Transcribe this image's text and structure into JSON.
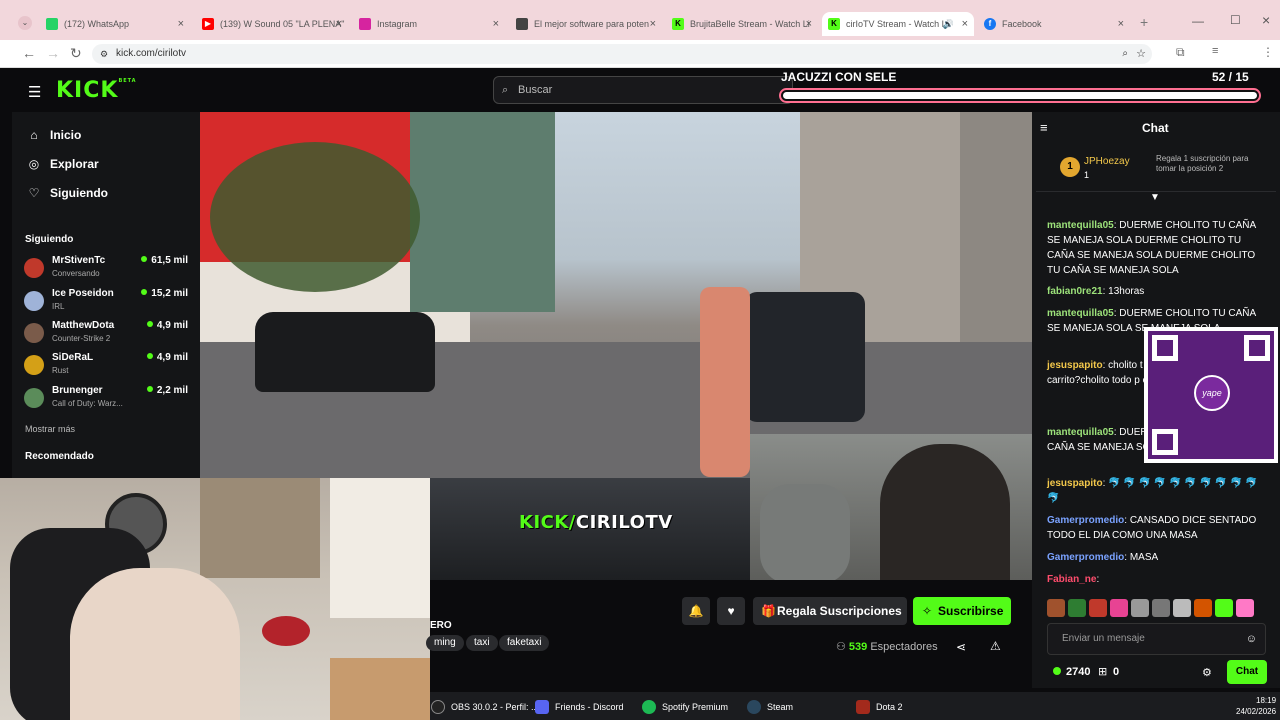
{
  "browser": {
    "tabs": [
      {
        "label": "(172) WhatsApp",
        "color": "#25d366"
      },
      {
        "label": "(139) W Sound 05 \"LA PLENA\"",
        "color": "#ff0000"
      },
      {
        "label": "Instagram",
        "color": "#d6249f"
      },
      {
        "label": "El mejor software para poten",
        "color": "#444444"
      },
      {
        "label": "BrujitaBelle Stream - Watch Li",
        "color": "#53fc18"
      },
      {
        "label": "cirIoTV Stream - Watch Li",
        "color": "#53fc18"
      },
      {
        "label": "Facebook",
        "color": "#1877f2"
      }
    ],
    "url": "kick.com/cirilotv"
  },
  "kick": {
    "logo": "KICK",
    "logo_beta": "BETA",
    "search_placeholder": "Buscar",
    "goal_title": "JACUZZI CON SELE",
    "goal_count": "52  / 15",
    "goal_progress": 1.0
  },
  "sidebar": {
    "nav": [
      {
        "label": "Inicio",
        "icon": "home-icon"
      },
      {
        "label": "Explorar",
        "icon": "compass-icon"
      },
      {
        "label": "Siguiendo",
        "icon": "heart-icon"
      }
    ],
    "following_title": "Siguiendo",
    "following": [
      {
        "name": "MrStivenTc",
        "category": "Conversando",
        "viewers": "61,5 mil",
        "color": "#c0392b"
      },
      {
        "name": "Ice Poseidon",
        "category": "IRL",
        "viewers": "15,2 mil",
        "color": "#9fb3d8"
      },
      {
        "name": "MatthewDota",
        "category": "Counter-Strike 2",
        "viewers": "4,9 mil",
        "color": "#7a5b4a"
      },
      {
        "name": "SiDeRaL",
        "category": "Rust",
        "viewers": "4,9 mil",
        "color": "#d4a017"
      },
      {
        "name": "Brunenger",
        "category": "Call of Duty: Warz...",
        "viewers": "2,2 mil",
        "color": "#5b8c5a"
      }
    ],
    "show_more": "Mostrar más",
    "recommended_title": "Recomendado"
  },
  "video": {
    "overlay_prefix": "KICK/",
    "overlay_name": "CIRILOTV"
  },
  "stream": {
    "title_fragment": "ERO",
    "tags": [
      "ming",
      "taxi",
      "faketaxi"
    ],
    "gift_label": "Regala Suscripciones",
    "subscribe_label": "Suscribirse",
    "viewer_count": "539",
    "viewer_label": "Espectadores"
  },
  "chat": {
    "title": "Chat",
    "pinned_user": "JPHoezay",
    "pinned_count": "1",
    "pinned_text": "Regala 1 suscripción para tomar la posición",
    "pinned_position": "2",
    "messages": [
      {
        "user": "mantequilla05",
        "text": "DUERME CHOLITO TU CAÑA SE MANEJA SOLA DUERME CHOLITO TU CAÑA SE MANEJA SOLA DUERME CHOLITO TU CAÑA SE MANEJA SOLA",
        "color": "#9de37b"
      },
      {
        "user": "fabian0re21",
        "text": "13horas",
        "color": "#9de37b"
      },
      {
        "user": "mantequilla05",
        "text": "DUERME CHOLITO TU CAÑA SE MANEJA SOLA SE MANEJA SOLA",
        "color": "#9de37b"
      },
      {
        "user": "jesuspapito",
        "text": "cholito t el carrito?cholito todo el carrito?cholito todo p carrito?",
        "color": "#f3c84b"
      },
      {
        "user": "mantequilla05",
        "text": "DUER SE MANEJA SOLA CAÑA SE MANEJA SOLA",
        "color": "#9de37b"
      },
      {
        "user": "jesuspapito",
        "text": "🐬 🐬 🐬 🐬 🐬 🐬 🐬 🐬 🐬 🐬 🐬",
        "color": "#f3c84b"
      },
      {
        "user": "Gamerpromedio",
        "text": "CANSADO DICE SENTADO TODO EL DIA COMO UNA MASA",
        "color": "#7aa2ff"
      },
      {
        "user": "Gamerpromedio",
        "text": "MASA",
        "color": "#7aa2ff"
      },
      {
        "user": "Fabian_ne",
        "text": "",
        "color": "#ff4d6d"
      }
    ],
    "input_placeholder": "Enviar un mensaje",
    "points": "2740",
    "gifts": "0",
    "send_label": "Chat"
  },
  "taskbar": {
    "items": [
      {
        "label": "OBS 30.0.2 - Perfil: ...",
        "color": "#222222"
      },
      {
        "label": "Friends - Discord",
        "color": "#5865f2"
      },
      {
        "label": "Spotify Premium",
        "color": "#1db954"
      },
      {
        "label": "Steam",
        "color": "#1b2838"
      },
      {
        "label": "Dota 2",
        "color": "#a32a1c"
      }
    ],
    "time": "18:19",
    "date": "24/02/2026"
  }
}
